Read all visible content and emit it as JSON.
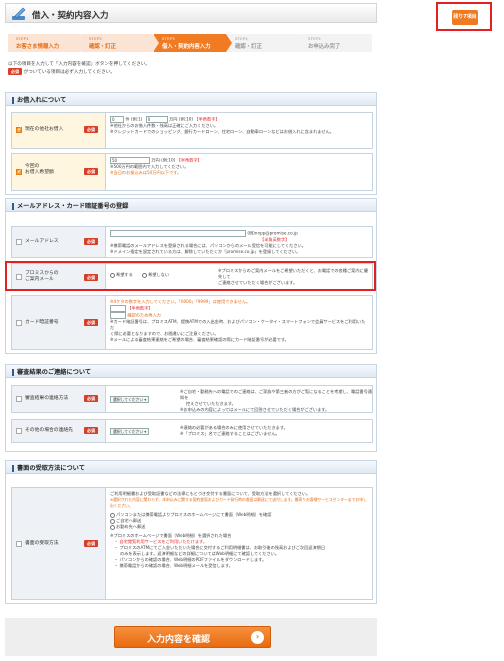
{
  "header": {
    "title": "借入・契約内容入力",
    "corner_button": "残り7項目"
  },
  "steps": [
    {
      "num": "STEP1",
      "label": "お客さま情報入力",
      "state": "done"
    },
    {
      "num": "STEP2",
      "label": "確認・訂正",
      "state": "done"
    },
    {
      "num": "STEP3",
      "label": "借入・契約内容入力",
      "state": "current"
    },
    {
      "num": "STEP4",
      "label": "確認・訂正",
      "state": "todo"
    },
    {
      "num": "STEP5",
      "label": "お申込み完了",
      "state": "todo"
    }
  ],
  "intro": {
    "line1": "以下の項目を入力して「入力内容を確認」ボタンを押してください。",
    "req": "必須",
    "line2": "がついている項目は必ず入力してください。"
  },
  "sections": {
    "borrow": {
      "title": "お借入れについて",
      "current_borrow": {
        "label": "現在の他社お借入",
        "req": "必須",
        "count_value": "0",
        "count_unit": "件",
        "count_ex": "(例:1)",
        "amount_value": "0",
        "amount_unit": "万円",
        "amount_ex": "(例:10)",
        "half": "【半角数字】",
        "note1": "※他社からのお借入件数・残高は正確にご入力ください。",
        "note2": "※クレジットカードでのショッピング、銀行カードローン、住宅ローン、自動車ローンなどはお借入れに含まれません。"
      },
      "desired": {
        "label1": "今回の",
        "label2": "お借入希望額",
        "req": "必須",
        "value": "50",
        "unit": "万円",
        "ex": "(例:10)",
        "half": "【半角数字】",
        "note1": "※500万円の範囲内で入力してください。",
        "note2": "※当日のお振込みは50万円以下です。"
      }
    },
    "mail": {
      "title": "メールアドレス・カード暗証番号の登録",
      "email": {
        "label": "メールアドレス",
        "req": "必須",
        "ex": "(例)nnpp@promise.co.jp",
        "half": "【半角英数字】",
        "note1": "※携帯電話のメールアドレスを登録される場合には、パソコンからのメール受信を可能にしてください。",
        "note2": "※ドメイン指定を設定されている方は、解除していただくか「promise.co.jp」を登録してください。"
      },
      "promo": {
        "label1": "プロミスからの",
        "label2": "ご案内メール",
        "req": "必須",
        "opt1": "希望する",
        "opt2": "希望しない",
        "note1": "※プロミスからのご案内メールをご希望いただくと、お電話での各種ご案内に優先して",
        "note2": "ご連絡させていただく場合がございます。"
      },
      "pin": {
        "label": "カード暗証番号",
        "req": "必須",
        "warn1": "※4ケタの数字を入力してください。「0000」「9999」は使用できません。",
        "half": "【半角数字】",
        "confirm": "確認のため再入力",
        "note1": "※カード暗証番号は、プロミスATM、提携ATMでの入出金時、およびパソコン・ケータイ・スマートフォンで会員サービスをご利用いただ",
        "note2": "く際に必要となりますので、お間違いにご注意ください。",
        "note3": "※メールによる審査結果連絡をご希望の場合、審査結果確認の際にカード暗証番号が必要です。"
      }
    },
    "contact": {
      "title": "審査結果のご連絡について",
      "method": {
        "label": "審査結果の連絡方法",
        "req": "必須",
        "select": "選択してください",
        "note1": "※ご自宅・勤務先への電話でのご連絡は、ご家族や第三者の方がご覧になることを考慮し、電話番号通知を",
        "note2": "控えさせていただきます。",
        "note3": "※お申込みの内容によってはメールにて回答させていただく場合がございます。"
      },
      "other": {
        "label": "その他の場合の連絡先",
        "req": "必須",
        "select": "選択してください",
        "note1": "※連絡の必要がある場合のみに使用させていただきます。",
        "note2": "※「プロミス」名でご連絡することはございません。"
      }
    },
    "docs": {
      "title": "書面の受取方法について",
      "receive": {
        "label": "書面の受取方法",
        "req": "必須",
        "intro": "ご利用明細書および受取証書などの法律にもとづき交付する書面について、受取方法を選択してください。",
        "warn": "※選択された内容に関わらず、本申込みに関する契約書面およびカード発行時の書面は郵送にて送付します。最寄りお客様サービスセンターまでお申し出ください。",
        "opt1": "パソコンまたは携帯電話よりプロミスのホームページにて書面（Web明細）を確認",
        "opt2": "ご自宅へ郵送",
        "opt3": "お勤め先へ郵送",
        "note_head": "※プロミスのホームページで書面（Web明細）を選択された場合",
        "b1": "・ 自宅閲覧利用サービスをご利用いただけます。",
        "b2": "・ プロミスのATMにてご入金いただいた場合に交付するご利用明細書は、お取引後の残高およびご次回返済期日",
        "b2b": "のみを表示します。返済明細などの詳細についてはWeb明細にて確認してください。",
        "b3": "・ パソコンからの確認の場合、Web明細のPDFファイルをダウンロードします。",
        "b4": "・ 携帯電話からの確認の場合、Web明細メールを受信します。"
      }
    }
  },
  "submit": {
    "label": "入力内容を確認",
    "arrow": "›"
  },
  "colors": {
    "accent": "#f07b22",
    "required": "#d6402b",
    "highlight": "#e52021"
  }
}
